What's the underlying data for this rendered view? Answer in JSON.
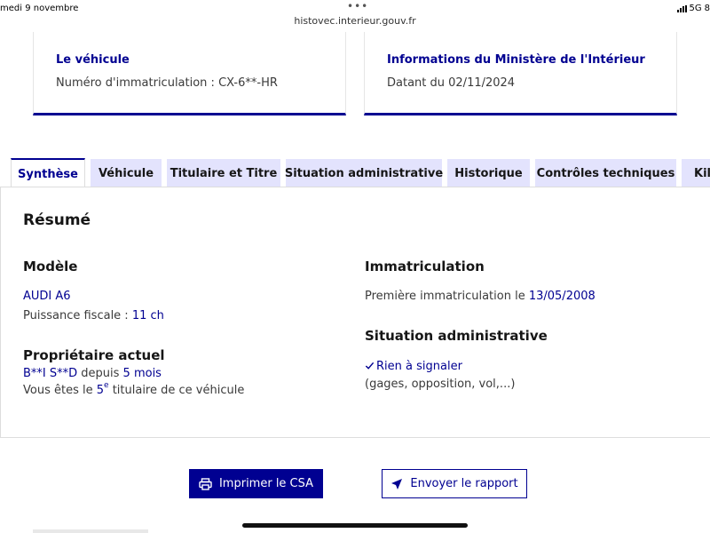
{
  "status_bar": {
    "time": "medi 9 novembre",
    "network": "5G",
    "battery_fragment": "8"
  },
  "browser": {
    "url": "histovec.interieur.gouv.fr"
  },
  "cards": {
    "vehicle": {
      "title": "Le véhicule",
      "label": "Numéro d'immatriculation : ",
      "value": "CX-6**-HR"
    },
    "ministry": {
      "title": "Informations du Ministère de l'Intérieur",
      "label": "Datant du ",
      "value": "02/11/2024"
    }
  },
  "tabs": [
    {
      "label": "Synthèse",
      "active": true
    },
    {
      "label": "Véhicule"
    },
    {
      "label": "Titulaire et Titre"
    },
    {
      "label": "Situation administrative"
    },
    {
      "label": "Historique"
    },
    {
      "label": "Contrôles techniques"
    },
    {
      "label": "Kilo"
    }
  ],
  "summary": {
    "title": "Résumé",
    "model": {
      "heading": "Modèle",
      "name": "AUDI A6",
      "power_label": "Puissance fiscale : ",
      "power_value": "11 ch"
    },
    "owner": {
      "heading": "Propriétaire actuel",
      "name": "B**I S**D",
      "since_label": " depuis ",
      "since_value": "5 mois",
      "rank_prefix": "Vous êtes le ",
      "rank_number": "5",
      "rank_sup": "e",
      "rank_suffix": " titulaire de ce véhicule"
    },
    "registration": {
      "heading": "Immatriculation",
      "label": "Première immatriculation le ",
      "date": "13/05/2008"
    },
    "admin": {
      "heading": "Situation administrative",
      "status": "Rien à signaler",
      "details": "(gages, opposition, vol,...)"
    }
  },
  "actions": {
    "print_label": "Imprimer le CSA",
    "send_label": "Envoyer le rapport"
  },
  "colors": {
    "brand_blue": "#000091",
    "tab_background": "#e3e3fd"
  }
}
